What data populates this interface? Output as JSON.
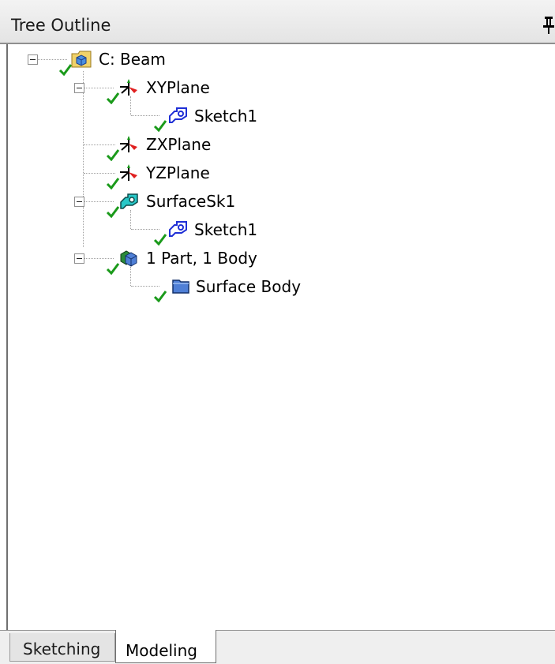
{
  "panel": {
    "title": "Tree Outline"
  },
  "tree": {
    "nodes": [
      {
        "label": "C: Beam",
        "icon": "geometry-folder-icon"
      },
      {
        "label": "XYPlane",
        "icon": "plane-axes-icon"
      },
      {
        "label": "Sketch1",
        "icon": "sketch-icon"
      },
      {
        "label": "ZXPlane",
        "icon": "plane-axes-icon"
      },
      {
        "label": "YZPlane",
        "icon": "plane-axes-icon"
      },
      {
        "label": "SurfaceSk1",
        "icon": "surface-from-sketch-icon"
      },
      {
        "label": "Sketch1",
        "icon": "sketch-icon"
      },
      {
        "label": "1 Part, 1 Body",
        "icon": "part-body-icon"
      },
      {
        "label": "Surface Body",
        "icon": "surface-body-icon"
      }
    ]
  },
  "tabs": [
    {
      "label": "Sketching",
      "active": false
    },
    {
      "label": "Modeling",
      "active": true
    }
  ],
  "colors": {
    "check": "#1a9a1a",
    "sketch_outline": "#1f2fd6",
    "surface_fill": "#28c8c8",
    "body_fill": "#4f7fd6"
  }
}
